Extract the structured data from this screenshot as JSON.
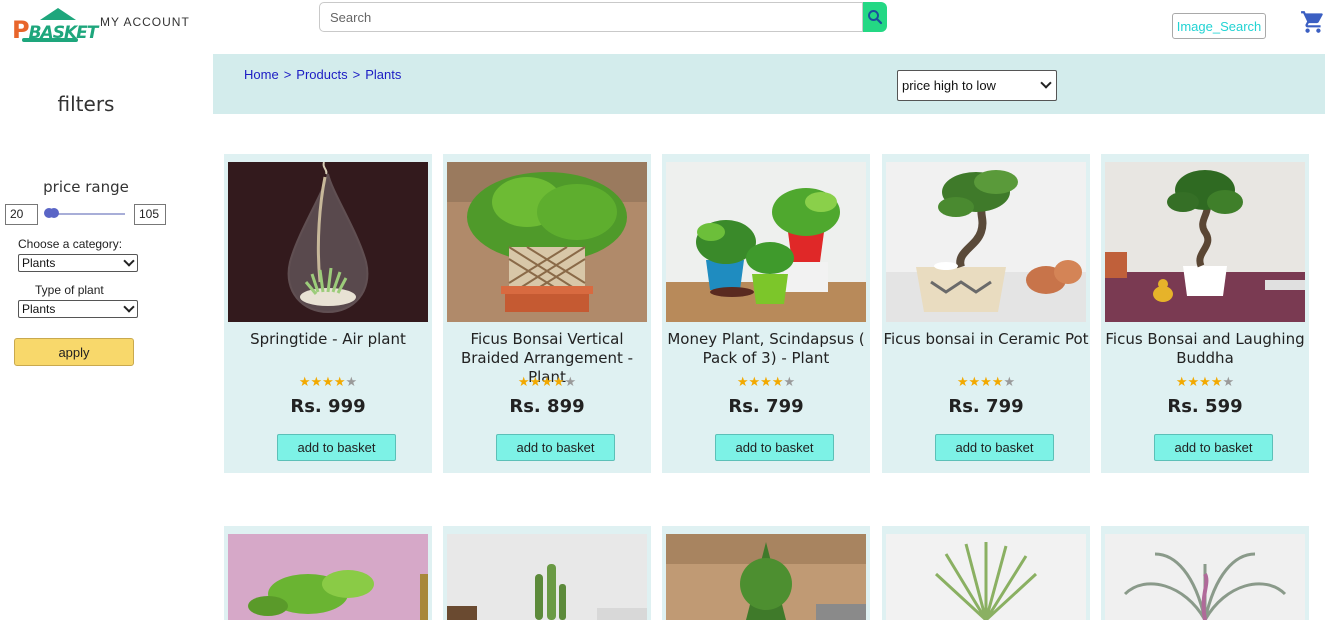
{
  "header": {
    "logo_text": "PBASKET",
    "account_label": "MY ACCOUNT",
    "search_placeholder": "Search",
    "image_search_label": "Image_Search"
  },
  "sidebar": {
    "title": "filters",
    "price_range_label": "price range",
    "price_min": "20",
    "price_max": "105",
    "category_label": "Choose a category:",
    "category_value": "Plants",
    "plant_type_label": "Type of plant",
    "plant_type_value": "Plants",
    "apply_label": "apply"
  },
  "breadcrumb": {
    "home": "Home",
    "products": "Products",
    "plants": "Plants",
    "separator": ">"
  },
  "sort": {
    "selected": "price high to low"
  },
  "products": [
    {
      "name": "Springtide - Air plant",
      "rating": 4,
      "max_rating": 5,
      "price": "Rs. 999",
      "button": "add to basket",
      "image": "glass-teardrop-air-plant"
    },
    {
      "name": "Ficus Bonsai Vertical Braided Arrangement - Plant",
      "rating": 4,
      "max_rating": 5,
      "price": "Rs. 899",
      "button": "add to basket",
      "image": "braided-bonsai"
    },
    {
      "name": "Money Plant, Scindapsus ( Pack of 3) - Plant",
      "rating": 4,
      "max_rating": 5,
      "price": "Rs. 799",
      "button": "add to basket",
      "image": "money-plants-pots"
    },
    {
      "name": "Ficus bonsai in Ceramic Pot",
      "rating": 4,
      "max_rating": 5,
      "price": "Rs. 799",
      "button": "add to basket",
      "image": "bonsai-ceramic-pot"
    },
    {
      "name": "Ficus Bonsai and Laughing Buddha",
      "rating": 4,
      "max_rating": 5,
      "price": "Rs. 599",
      "button": "add to basket",
      "image": "bonsai-buddha"
    }
  ],
  "products_row2": [
    {
      "image": "pothos-pink-wall"
    },
    {
      "image": "cactus-white"
    },
    {
      "image": "conifer-bokeh"
    },
    {
      "image": "air-plant-white"
    },
    {
      "image": "purple-air-plant"
    }
  ],
  "colors": {
    "topbar_bg": "#d3ecec",
    "card_bg": "#dff1f2",
    "add_button": "#7df2e6",
    "apply_button": "#f8d86b",
    "search_button": "#24d884",
    "link": "#1c1cc4"
  }
}
